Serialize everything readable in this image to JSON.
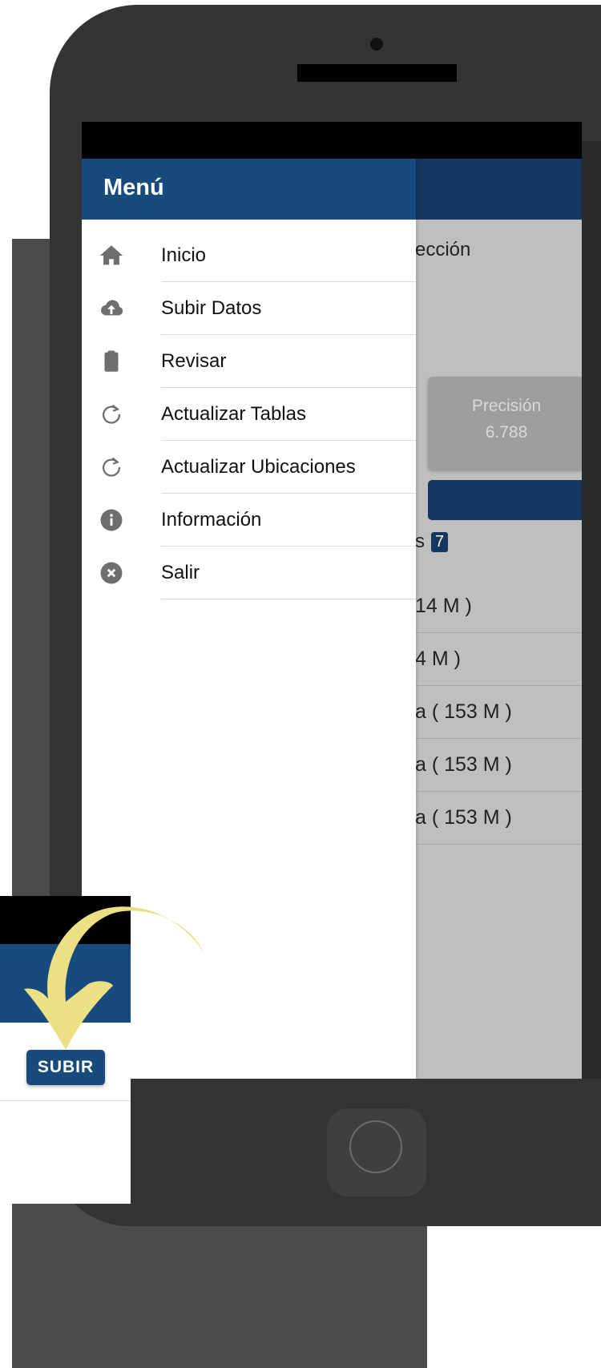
{
  "drawer": {
    "title": "Menú",
    "items": [
      {
        "label": "Inicio",
        "icon": "home-icon"
      },
      {
        "label": "Subir Datos",
        "icon": "cloud-upload-icon"
      },
      {
        "label": "Revisar",
        "icon": "clipboard-icon"
      },
      {
        "label": "Actualizar Tablas",
        "icon": "refresh-icon"
      },
      {
        "label": "Actualizar Ubicaciones",
        "icon": "refresh-icon"
      },
      {
        "label": "Información",
        "icon": "info-icon"
      },
      {
        "label": "Salir",
        "icon": "close-circle-icon"
      }
    ]
  },
  "background_content": {
    "heading_fragment": "ección",
    "precision_label": "Precisión",
    "precision_value": "6.788",
    "count_label_fragment": "s",
    "count_badge": "7",
    "rows": [
      "14 M )",
      "4 M )",
      "a ( 153 M )",
      "a ( 153 M )",
      "a ( 153 M )"
    ]
  },
  "inset": {
    "button_label": "SUBIR"
  },
  "colors": {
    "app_bar": "#14375f",
    "drawer_header": "#174b7e",
    "arrow": "#ebe084",
    "phone_body": "#333333"
  }
}
